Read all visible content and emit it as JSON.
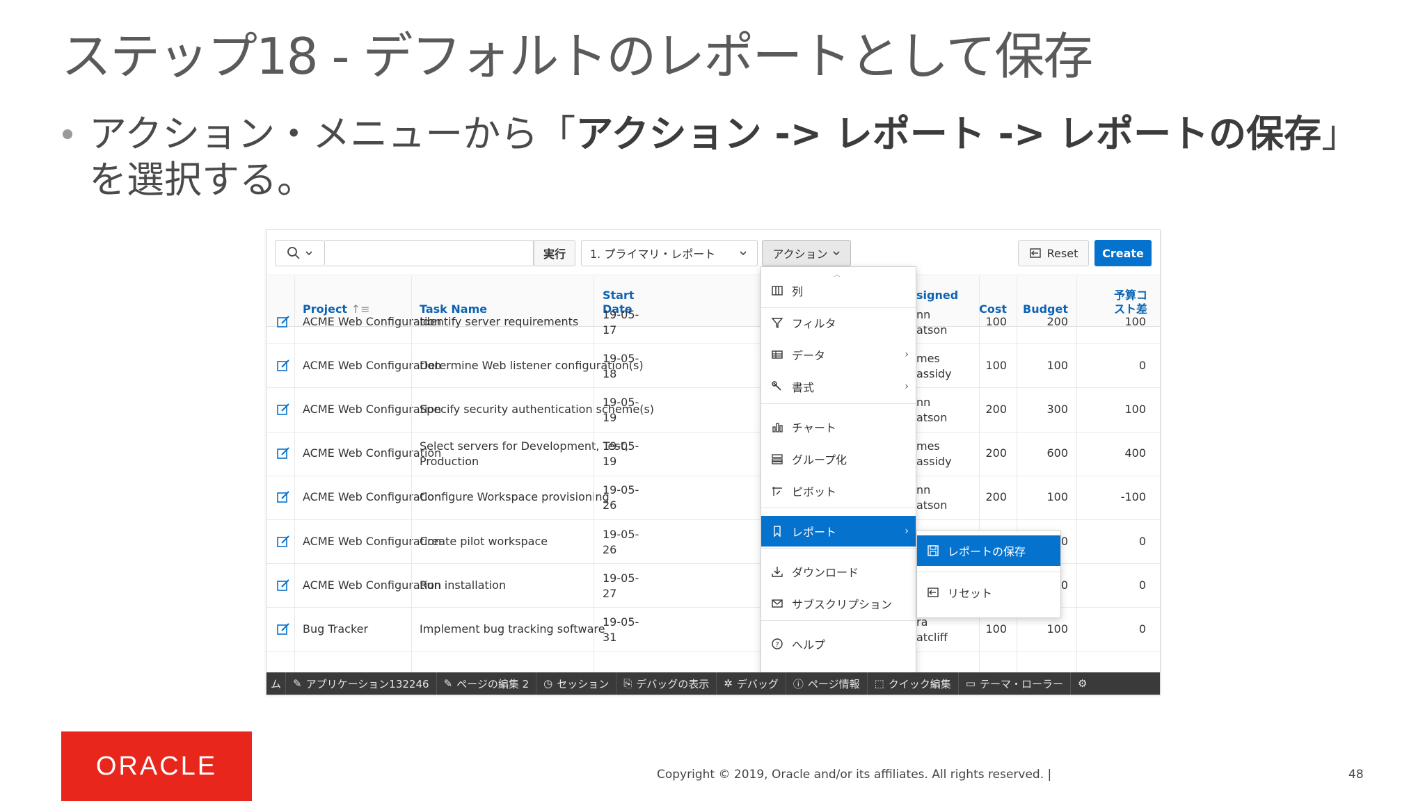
{
  "slide": {
    "title": "ステップ18 - デフォルトのレポートとして保存",
    "bullet_pre": "アクション・メニューから「",
    "bullet_bold": "アクション -> レポート -> レポートの保存",
    "bullet_post": "」を選択する。",
    "page_number": "48",
    "copyright": "Copyright © 2019, Oracle and/or its affiliates. All rights reserved.  |",
    "logo_text": "ORACLE"
  },
  "toolbar": {
    "go_label": "実行",
    "report_select_value": "1. プライマリ・レポート",
    "actions_label": "アクション",
    "reset_label": "Reset",
    "create_label": "Create"
  },
  "table": {
    "headers": {
      "project": "Project",
      "task": "Task Name",
      "start1": "Start",
      "start2": "Date",
      "assigned": "signed",
      "cost": "Cost",
      "budget": "Budget",
      "diff1": "予算コ",
      "diff2": "スト差"
    },
    "rows": [
      {
        "project": "ACME Web Configuration",
        "task": "Identify server requirements",
        "task2": "",
        "date1": "19-05-",
        "date2": "17",
        "as1": "nn",
        "as2": "atson",
        "cost": "100",
        "budget": "200",
        "diff": "100"
      },
      {
        "project": "ACME Web Configuration",
        "task": "Determine Web listener configuration(s)",
        "task2": "",
        "date1": "19-05-",
        "date2": "18",
        "as1": "mes",
        "as2": "assidy",
        "cost": "100",
        "budget": "100",
        "diff": "0"
      },
      {
        "project": "ACME Web Configuration",
        "task": "Specify security authentication scheme(s)",
        "task2": "",
        "date1": "19-05-",
        "date2": "19",
        "as1": "nn",
        "as2": "atson",
        "cost": "200",
        "budget": "300",
        "diff": "100"
      },
      {
        "project": "ACME Web Configuration",
        "task": "Select servers for Development, Test,",
        "task2": "Production",
        "date1": "19-05-",
        "date2": "19",
        "as1": "mes",
        "as2": "assidy",
        "cost": "200",
        "budget": "600",
        "diff": "400"
      },
      {
        "project": "ACME Web Configuration",
        "task": "Configure Workspace provisioning",
        "task2": "",
        "date1": "19-05-",
        "date2": "26",
        "as1": "nn",
        "as2": "atson",
        "cost": "200",
        "budget": "100",
        "diff": "-100"
      },
      {
        "project": "ACME Web Configuration",
        "task": "Create pilot workspace",
        "task2": "",
        "date1": "19-05-",
        "date2": "26",
        "as1": "",
        "as2": "",
        "cost": "",
        "budget": "100",
        "diff": "0"
      },
      {
        "project": "ACME Web Configuration",
        "task": "Run installation",
        "task2": "",
        "date1": "19-05-",
        "date2": "27",
        "as1": "",
        "as2": "ssidy",
        "cost": "",
        "budget": "100",
        "diff": "0"
      },
      {
        "project": "Bug Tracker",
        "task": "Implement bug tracking software",
        "task2": "",
        "date1": "19-05-",
        "date2": "31",
        "as1": "ra",
        "as2": "atcliff",
        "cost": "100",
        "budget": "100",
        "diff": "0"
      }
    ]
  },
  "actions_menu": {
    "items": [
      "列",
      "フィルタ",
      "データ",
      "書式",
      "チャート",
      "グループ化",
      "ピボット",
      "レポート",
      "ダウンロード",
      "サブスクリプション",
      "ヘルプ"
    ]
  },
  "report_submenu": {
    "items": [
      "レポートの保存",
      "リセット"
    ]
  },
  "dev_toolbar": {
    "items": [
      "ム",
      "アプリケーション132246",
      "ページの編集 2",
      "セッション",
      "デバッグの表示",
      "デバッグ",
      "ページ情報",
      "クイック編集",
      "テーマ・ローラー"
    ]
  }
}
